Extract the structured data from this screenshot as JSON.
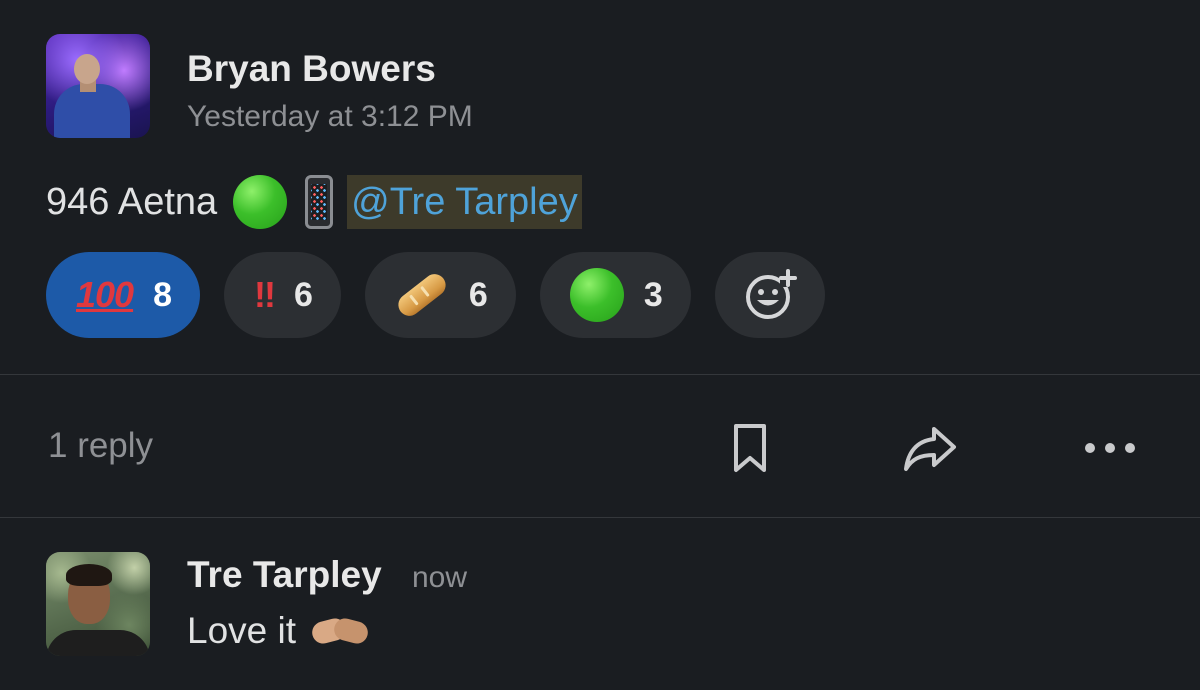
{
  "message": {
    "author": "Bryan Bowers",
    "timestamp": "Yesterday at 3:12 PM",
    "text": "946 Aetna",
    "emojis": [
      "green-circle",
      "mobile-phone"
    ],
    "mention": "@Tre Tarpley"
  },
  "reactions": [
    {
      "emoji": "100",
      "symbol": "100",
      "count": "8",
      "active": true
    },
    {
      "emoji": "double-exclamation",
      "symbol": "!!",
      "count": "6",
      "active": false
    },
    {
      "emoji": "baguette-bread",
      "symbol": "",
      "count": "6",
      "active": false
    },
    {
      "emoji": "green-circle",
      "symbol": "",
      "count": "3",
      "active": false
    }
  ],
  "add_reaction_icon": "add-reaction-icon",
  "thread": {
    "reply_count": "1 reply",
    "actions": [
      "bookmark-icon",
      "share-icon",
      "more-icon"
    ]
  },
  "reply": {
    "author": "Tre Tarpley",
    "timestamp": "now",
    "text": "Love it",
    "emoji": "handshake"
  },
  "colors": {
    "background": "#1a1d21",
    "active_reaction": "#1d5aa8",
    "reaction_bg": "#2c2f33",
    "mention_text": "#4fa3d9",
    "mention_bg": "#3d3a2a",
    "muted_text": "#8e9094"
  }
}
